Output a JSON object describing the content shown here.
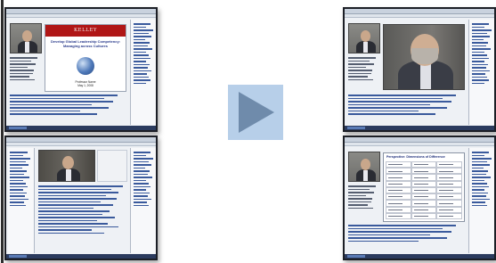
{
  "thumbnails": {
    "top_left": {
      "slide": {
        "header": "KELLEY",
        "title_line_1": "Develop Global Leadership Competency:",
        "title_line_2": "Managing across Cultures",
        "author": "Professor Name",
        "date": "May 1, 2008"
      }
    },
    "bottom_right": {
      "table_title": "Perspective: Dimensions of Difference"
    }
  },
  "player": {
    "play_icon": "play-icon",
    "colors": {
      "play_box": "#b7cfe9",
      "play_arrow": "#6f8bab"
    }
  }
}
